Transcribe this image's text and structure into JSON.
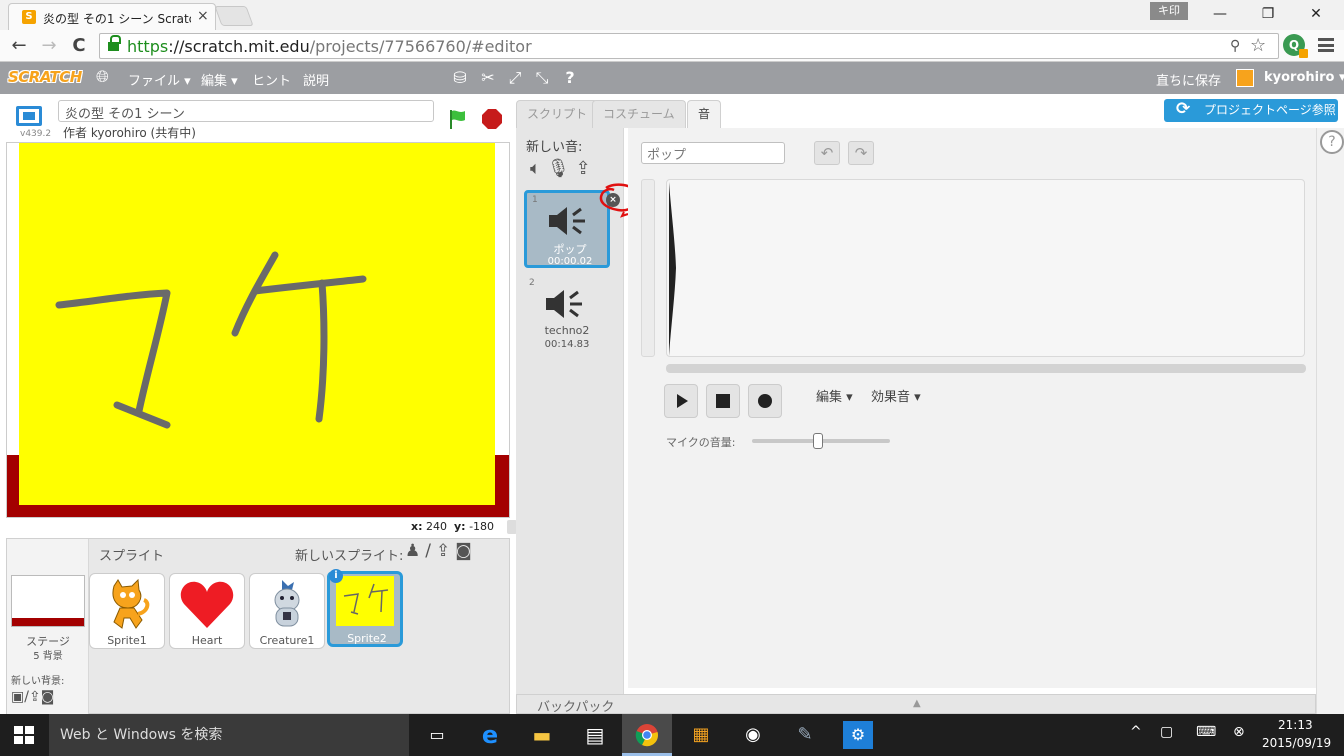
{
  "browser": {
    "tab_title": "炎の型 その1 シーン Scratch",
    "tab_close": "×",
    "ime_badge": "キ印",
    "window_controls": {
      "minimize": "—",
      "restore": "❐",
      "close": "✕"
    },
    "nav": {
      "back": "←",
      "forward": "→",
      "reload": "C"
    },
    "url_https": "https",
    "url_host": "://scratch.mit.edu",
    "url_path": "/projects/77566760/#editor"
  },
  "scratch_menu": {
    "logo": "SCRATCH",
    "file": "ファイル ▾",
    "edit": "編集 ▾",
    "tips": "ヒント",
    "about": "説明",
    "save_now": "直ちに保存",
    "username": "kyorohiro ▾"
  },
  "stage": {
    "project_title": "炎の型 その1 シーン",
    "version": "v439.2",
    "author": "作者 kyorohiro (共有中)",
    "drawing_text": "マケ",
    "coords_x_label": "x:",
    "coords_x": "240",
    "coords_y_label": "y:",
    "coords_y": "-180",
    "colors": {
      "background": "#ffff00",
      "floor": "#a30000"
    }
  },
  "sprite_library": {
    "title": "スプライト",
    "new_sprite": "新しいスプライト:",
    "stage_label": "ステージ",
    "backdrop_count": "5 背景",
    "new_backdrop": "新しい背景:",
    "sprites": [
      {
        "name": "Sprite1",
        "icon": "cat-sprite-icon"
      },
      {
        "name": "Heart",
        "icon": "heart-sprite-icon"
      },
      {
        "name": "Creature1",
        "icon": "creature-sprite-icon"
      },
      {
        "name": "Sprite2",
        "icon": "yellow-drawing-sprite-icon",
        "selected": true
      }
    ],
    "info_badge": "i"
  },
  "editor": {
    "tabs": [
      "スクリプト",
      "コスチューム",
      "音"
    ],
    "active_tab": "音",
    "project_page_button": "プロジェクトページ参照",
    "help": "?"
  },
  "sounds": {
    "new_sound": "新しい音:",
    "items": [
      {
        "index": "1",
        "name": "ポップ",
        "duration": "00:00.02",
        "selected": true
      },
      {
        "index": "2",
        "name": "techno2",
        "duration": "00:14.83"
      }
    ],
    "delete_badge": "×",
    "name_field": "ポップ",
    "undo": "↶",
    "redo": "↷",
    "edit_menu": "編集 ▾",
    "effects_menu": "効果音 ▾",
    "mic_volume_label": "マイクの音量:",
    "mic_volume_level": 0.48
  },
  "backpack": {
    "label": "バックパック",
    "arrow": "▲"
  },
  "taskbar": {
    "search_placeholder": "Web と Windows を検索",
    "time": "21:13",
    "date": "2015/09/19"
  }
}
